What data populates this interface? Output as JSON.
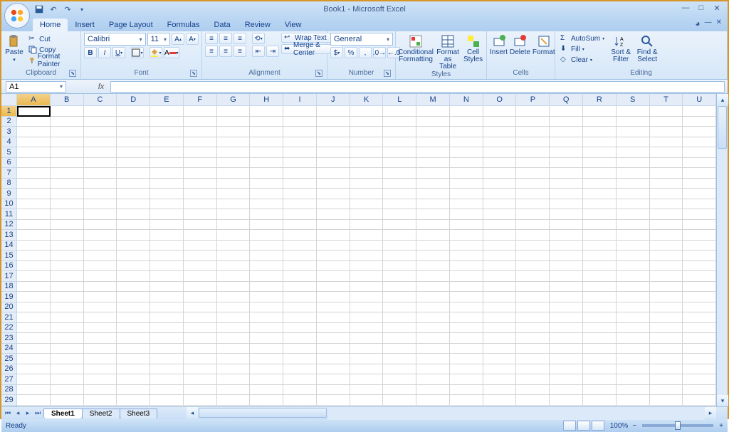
{
  "title": "Book1 - Microsoft Excel",
  "tabs": [
    "Home",
    "Insert",
    "Page Layout",
    "Formulas",
    "Data",
    "Review",
    "View"
  ],
  "activeTab": "Home",
  "clipboard": {
    "label": "Clipboard",
    "paste": "Paste",
    "cut": "Cut",
    "copy": "Copy",
    "fp": "Format Painter"
  },
  "font": {
    "label": "Font",
    "name": "Calibri",
    "size": "11"
  },
  "alignment": {
    "label": "Alignment",
    "wrap": "Wrap Text",
    "merge": "Merge & Center"
  },
  "number": {
    "label": "Number",
    "format": "General"
  },
  "styles": {
    "label": "Styles",
    "cond": "Conditional Formatting",
    "table": "Format as Table",
    "cell": "Cell Styles"
  },
  "cellsg": {
    "label": "Cells",
    "insert": "Insert",
    "delete": "Delete",
    "format": "Format"
  },
  "editing": {
    "label": "Editing",
    "autosum": "AutoSum",
    "fill": "Fill",
    "clear": "Clear",
    "sort": "Sort & Filter",
    "find": "Find & Select"
  },
  "namebox": "A1",
  "columns": [
    "A",
    "B",
    "C",
    "D",
    "E",
    "F",
    "G",
    "H",
    "I",
    "J",
    "K",
    "L",
    "M",
    "N",
    "O",
    "P",
    "Q",
    "R",
    "S",
    "T",
    "U"
  ],
  "rows": 29,
  "sheets": [
    "Sheet1",
    "Sheet2",
    "Sheet3"
  ],
  "activeSheet": "Sheet1",
  "status": "Ready",
  "zoom": "100%"
}
